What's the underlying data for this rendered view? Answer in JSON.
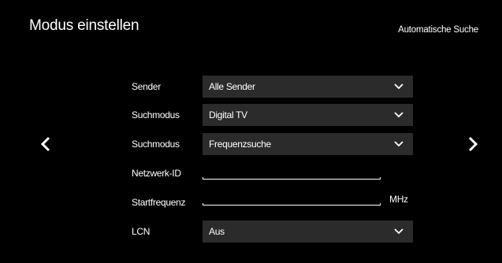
{
  "header": {
    "title": "Modus einstellen",
    "subtitle": "Automatische Suche"
  },
  "navigation": {
    "prev_icon": "chevron-left-icon",
    "next_icon": "chevron-right-icon"
  },
  "form": {
    "sender": {
      "label": "Sender",
      "value": "Alle Sender"
    },
    "suchmodus_1": {
      "label": "Suchmodus",
      "value": "Digital TV"
    },
    "suchmodus_2": {
      "label": "Suchmodus",
      "value": "Frequenzsuche"
    },
    "netzwerk_id": {
      "label": "Netzwerk-ID",
      "value": ""
    },
    "startfrequenz": {
      "label": "Startfrequenz",
      "value": "",
      "unit": "MHz"
    },
    "lcn": {
      "label": "LCN",
      "value": "Aus"
    }
  },
  "colors": {
    "background": "#000000",
    "select_background": "#2b2b2b",
    "text": "#ffffff"
  }
}
